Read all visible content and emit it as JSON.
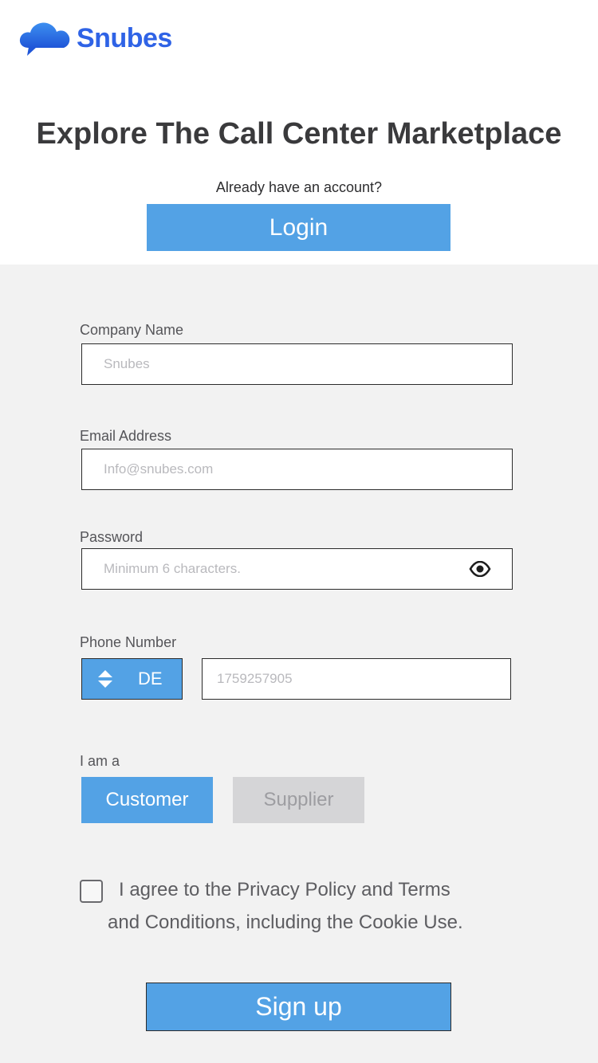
{
  "brand": {
    "name": "Snubes",
    "color": "#2f63e6",
    "icon": "cloud-chat-icon"
  },
  "header": {
    "title": "Explore The Call Center Marketplace",
    "already_text": "Already have an account?",
    "login_label": "Login"
  },
  "form": {
    "company": {
      "label": "Company Name",
      "placeholder": "Snubes"
    },
    "email": {
      "label": "Email Address",
      "placeholder": "Info@snubes.com"
    },
    "password": {
      "label": "Password",
      "placeholder": "Minimum 6 characters.",
      "toggle_icon": "eye-icon"
    },
    "phone": {
      "label": "Phone Number",
      "country_code": "DE",
      "placeholder": "1759257905"
    },
    "role": {
      "label": "I am a",
      "options": [
        "Customer",
        "Supplier"
      ],
      "selected": "Customer"
    },
    "agree": {
      "checked": false,
      "line1": "I agree to the Privacy Policy and Terms",
      "line2": "and Conditions, including the Cookie Use."
    },
    "signup_label": "Sign up"
  },
  "colors": {
    "accent": "#53a2e5",
    "form_bg": "#f2f2f2",
    "disabled": "#d5d5d7"
  }
}
